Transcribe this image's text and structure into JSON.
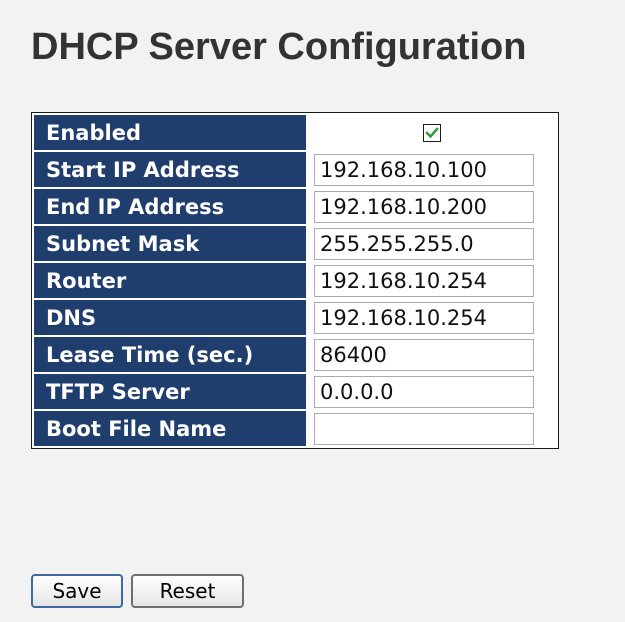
{
  "page": {
    "title": "DHCP Server Configuration"
  },
  "form": {
    "enabled": {
      "label": "Enabled",
      "checked": true
    },
    "fields": [
      {
        "label": "Start IP Address",
        "value": "192.168.10.100"
      },
      {
        "label": "End IP Address",
        "value": "192.168.10.200"
      },
      {
        "label": "Subnet Mask",
        "value": "255.255.255.0"
      },
      {
        "label": "Router",
        "value": "192.168.10.254"
      },
      {
        "label": "DNS",
        "value": "192.168.10.254"
      },
      {
        "label": "Lease Time (sec.)",
        "value": "86400"
      },
      {
        "label": "TFTP Server",
        "value": "0.0.0.0"
      },
      {
        "label": "Boot File Name",
        "value": ""
      }
    ]
  },
  "buttons": {
    "save_label": "Save",
    "reset_label": "Reset"
  },
  "colors": {
    "label_background": "#1f3e6d",
    "checkmark": "#2e9a2e",
    "page_background": "#f2f2f2"
  }
}
